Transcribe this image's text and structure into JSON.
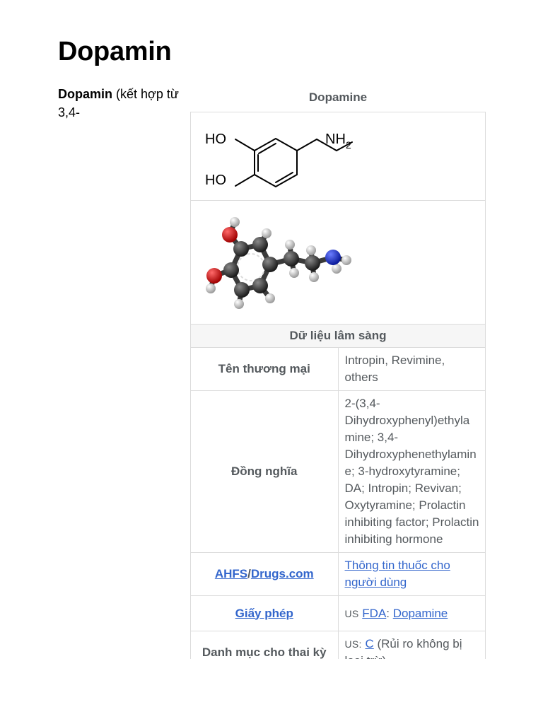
{
  "article": {
    "title": "Dopamin",
    "lead_bold": "Dopamin",
    "lead_rest": " (kết hợp từ 3,4-"
  },
  "infobox": {
    "caption": "Dopamine",
    "structure_2d": {
      "label_ho_top": "HO",
      "label_ho_bottom": "HO",
      "label_nh": "NH",
      "label_sub": "2"
    },
    "section_clinical": "Dữ liệu lâm sàng",
    "rows": {
      "trade_names": {
        "label": "Tên thương mại",
        "value": "Intropin, Revimine, others"
      },
      "synonyms": {
        "label": "Đồng nghĩa",
        "value": "2-(3,4-Dihydroxyphenyl)ethylamine; 3,4-Dihydroxyphenethylamine; 3-hydroxytyramine; DA; Intropin; Revivan; Oxytyramine; Prolactin inhibiting factor; Prolactin inhibiting hormone"
      },
      "ahfs": {
        "label_link1": "AHFS",
        "label_sep": "/",
        "label_link2": "Drugs.com",
        "value_link": "Thông tin thuốc cho người dùng"
      },
      "license": {
        "label_link": "Giấy phép",
        "prefix": "US",
        "link1": "FDA",
        "sep": ": ",
        "link2": "Dopamine"
      },
      "pregnancy": {
        "label": "Danh mục cho thai kỳ",
        "prefix": "US:",
        "link": "C",
        "rest": " (Rủi ro không bị loại trừ)"
      }
    }
  },
  "colors": {
    "link": "#3366cc",
    "label_text": "#54595d",
    "border": "#dcdcdc",
    "section_bg": "#f6f6f6",
    "oxygen": "#e00000",
    "nitrogen": "#1030e0",
    "carbon": "#2a2a2a",
    "hydrogen": "#e8e8e8"
  }
}
